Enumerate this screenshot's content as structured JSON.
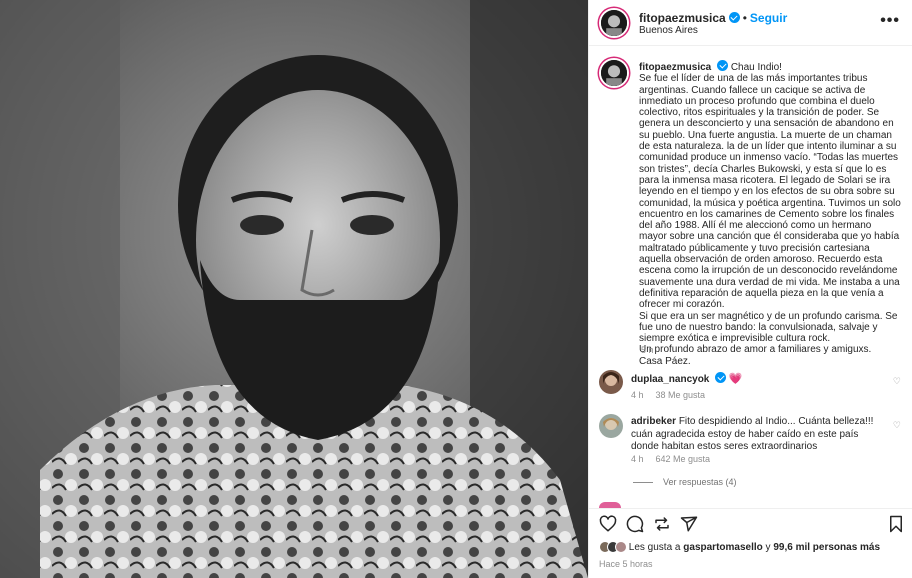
{
  "post": {
    "photo": {
      "description": "black and white portrait"
    },
    "header": {
      "username": "fitopaezmusica",
      "separator": "•",
      "follow_label": "Seguir",
      "location": "Buenos Aires",
      "more_icon": "more-horizontal-icon"
    },
    "caption": {
      "username": "fitopaezmusica",
      "lines": [
        "Chau Indio!",
        "Se fue el líder de una de las más importantes tribus argentinas. Cuando fallece un cacique se activa de inmediato un proceso profundo que combina el duelo colectivo, ritos espirituales y la transición de poder. Se genera un desconcierto y una sensación de abandono en su pueblo. Una fuerte angustia. La muerte de un chaman de esta naturaleza. la de un líder que intento iluminar a su comunidad produce un inmenso vacío. “Todas las muertes son tristes”, decía Charles Bukowski, y esta sí que lo es para la inmensa masa ricotera. El legado de Solari se ira leyendo en el tiempo y en los efectos de su obra sobre su comunidad, la música y poética argentina. Tuvimos un solo encuentro en los camarines de Cemento sobre los finales del año 1988. Allí él me aleccionó como un hermano mayor sobre una canción que él consideraba que yo había maltratado públicamente y tuvo precisión cartesiana aquella observación de orden amoroso. Recuerdo esta escena como la irrupción de un desconocido revelándome suavemente una dura verdad de mi vida. Me instaba a una definitiva reparación de aquella pieza en la que venía a ofrecer mi corazón.",
        "Si que era un ser magnético y de un profundo carisma. Se fue uno de nuestro bando: la convulsionada, salvaje y siempre exótica e imprevisible cultura rock.",
        "Un profundo abrazo de amor a familiares y amiguxs.",
        "Casa Páez."
      ],
      "time": "5 h"
    },
    "comments": [
      {
        "username": "duplaa_nancyok",
        "text": "💗",
        "time": "4 h",
        "likes": "38 Me gusta"
      },
      {
        "username": "adribeker",
        "text": "Fito despidiendo al Indio... Cuánta belleza!!! cuán agradecida estoy de haber caído en este país donde habitan estos seres extraordinarios",
        "time": "4 h",
        "likes": "642 Me gusta"
      }
    ],
    "view_replies": "Ver respuestas (4)",
    "like_comment_icon": "♡",
    "actions": {
      "like_icon": "heart-icon",
      "comment_icon": "comment-icon",
      "repost_icon": "repost-icon",
      "share_icon": "share-icon",
      "save_icon": "bookmark-icon"
    },
    "likes": {
      "prefix": "Les gusta a",
      "user": "gaspartomasello",
      "connector": "y",
      "count": "99,6 mil personas más"
    },
    "posted_ago": "Hace 5 horas"
  },
  "colors": {
    "accent": "#0095f6",
    "text": "#262626",
    "muted": "#8e8e8e",
    "border": "#efefef",
    "heart": "#ed4956"
  }
}
